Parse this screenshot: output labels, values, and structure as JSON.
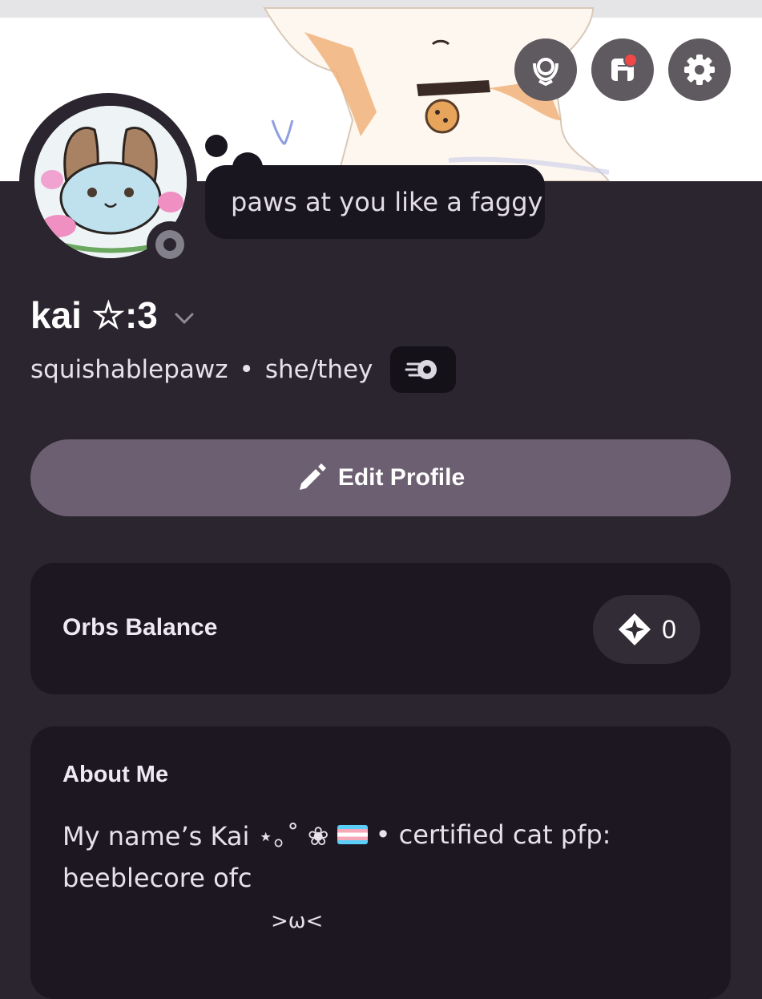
{
  "profile": {
    "display_name": "kai ☆:3",
    "username": "squishablepawz",
    "separator": "•",
    "pronouns": "she/they",
    "status_text": "paws at you like a faggy"
  },
  "actions": {
    "edit_profile_label": "Edit Profile"
  },
  "orbs": {
    "label": "Orbs Balance",
    "value": "0"
  },
  "about": {
    "title": "About Me",
    "line1_prefix": "My name’s Kai ⋆｡˚ ❀",
    "line1_suffix": "• certified cat   pfp:",
    "line2": "beeblecore ofc",
    "line3": ">ω<"
  },
  "colors": {
    "background": "#2b2530",
    "card": "#1c1721",
    "edit_button": "#6c5f71",
    "notification": "#f04747"
  },
  "icons": [
    "nitro-laurel-icon",
    "shop-icon",
    "gear-icon",
    "chevron-down-icon",
    "nitro-badge-icon",
    "pencil-icon",
    "orb-icon",
    "status-idle-icon"
  ]
}
